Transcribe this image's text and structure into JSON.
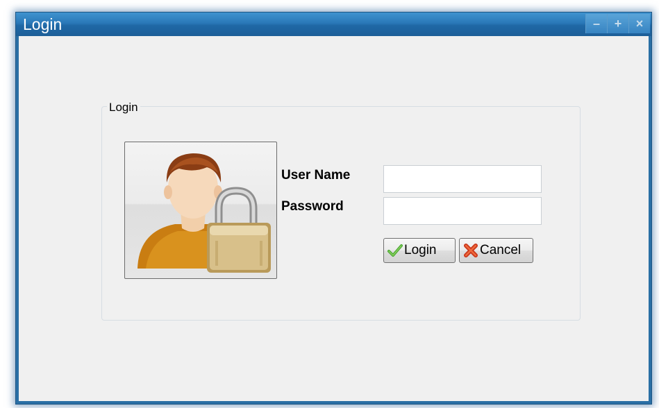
{
  "window": {
    "title": "Login",
    "controls": {
      "minimize_icon": "minimize-icon",
      "maximize_icon": "maximize-icon",
      "close_icon": "close-icon"
    },
    "accent_color": "#2a78b8"
  },
  "group": {
    "legend": "Login",
    "image": "user-lock-icon"
  },
  "form": {
    "username_label": "User Name",
    "password_label": "Password",
    "username_value": "",
    "password_value": ""
  },
  "buttons": {
    "login_label": "Login",
    "login_icon": "checkmark-icon",
    "cancel_label": "Cancel",
    "cancel_icon": "x-icon"
  }
}
